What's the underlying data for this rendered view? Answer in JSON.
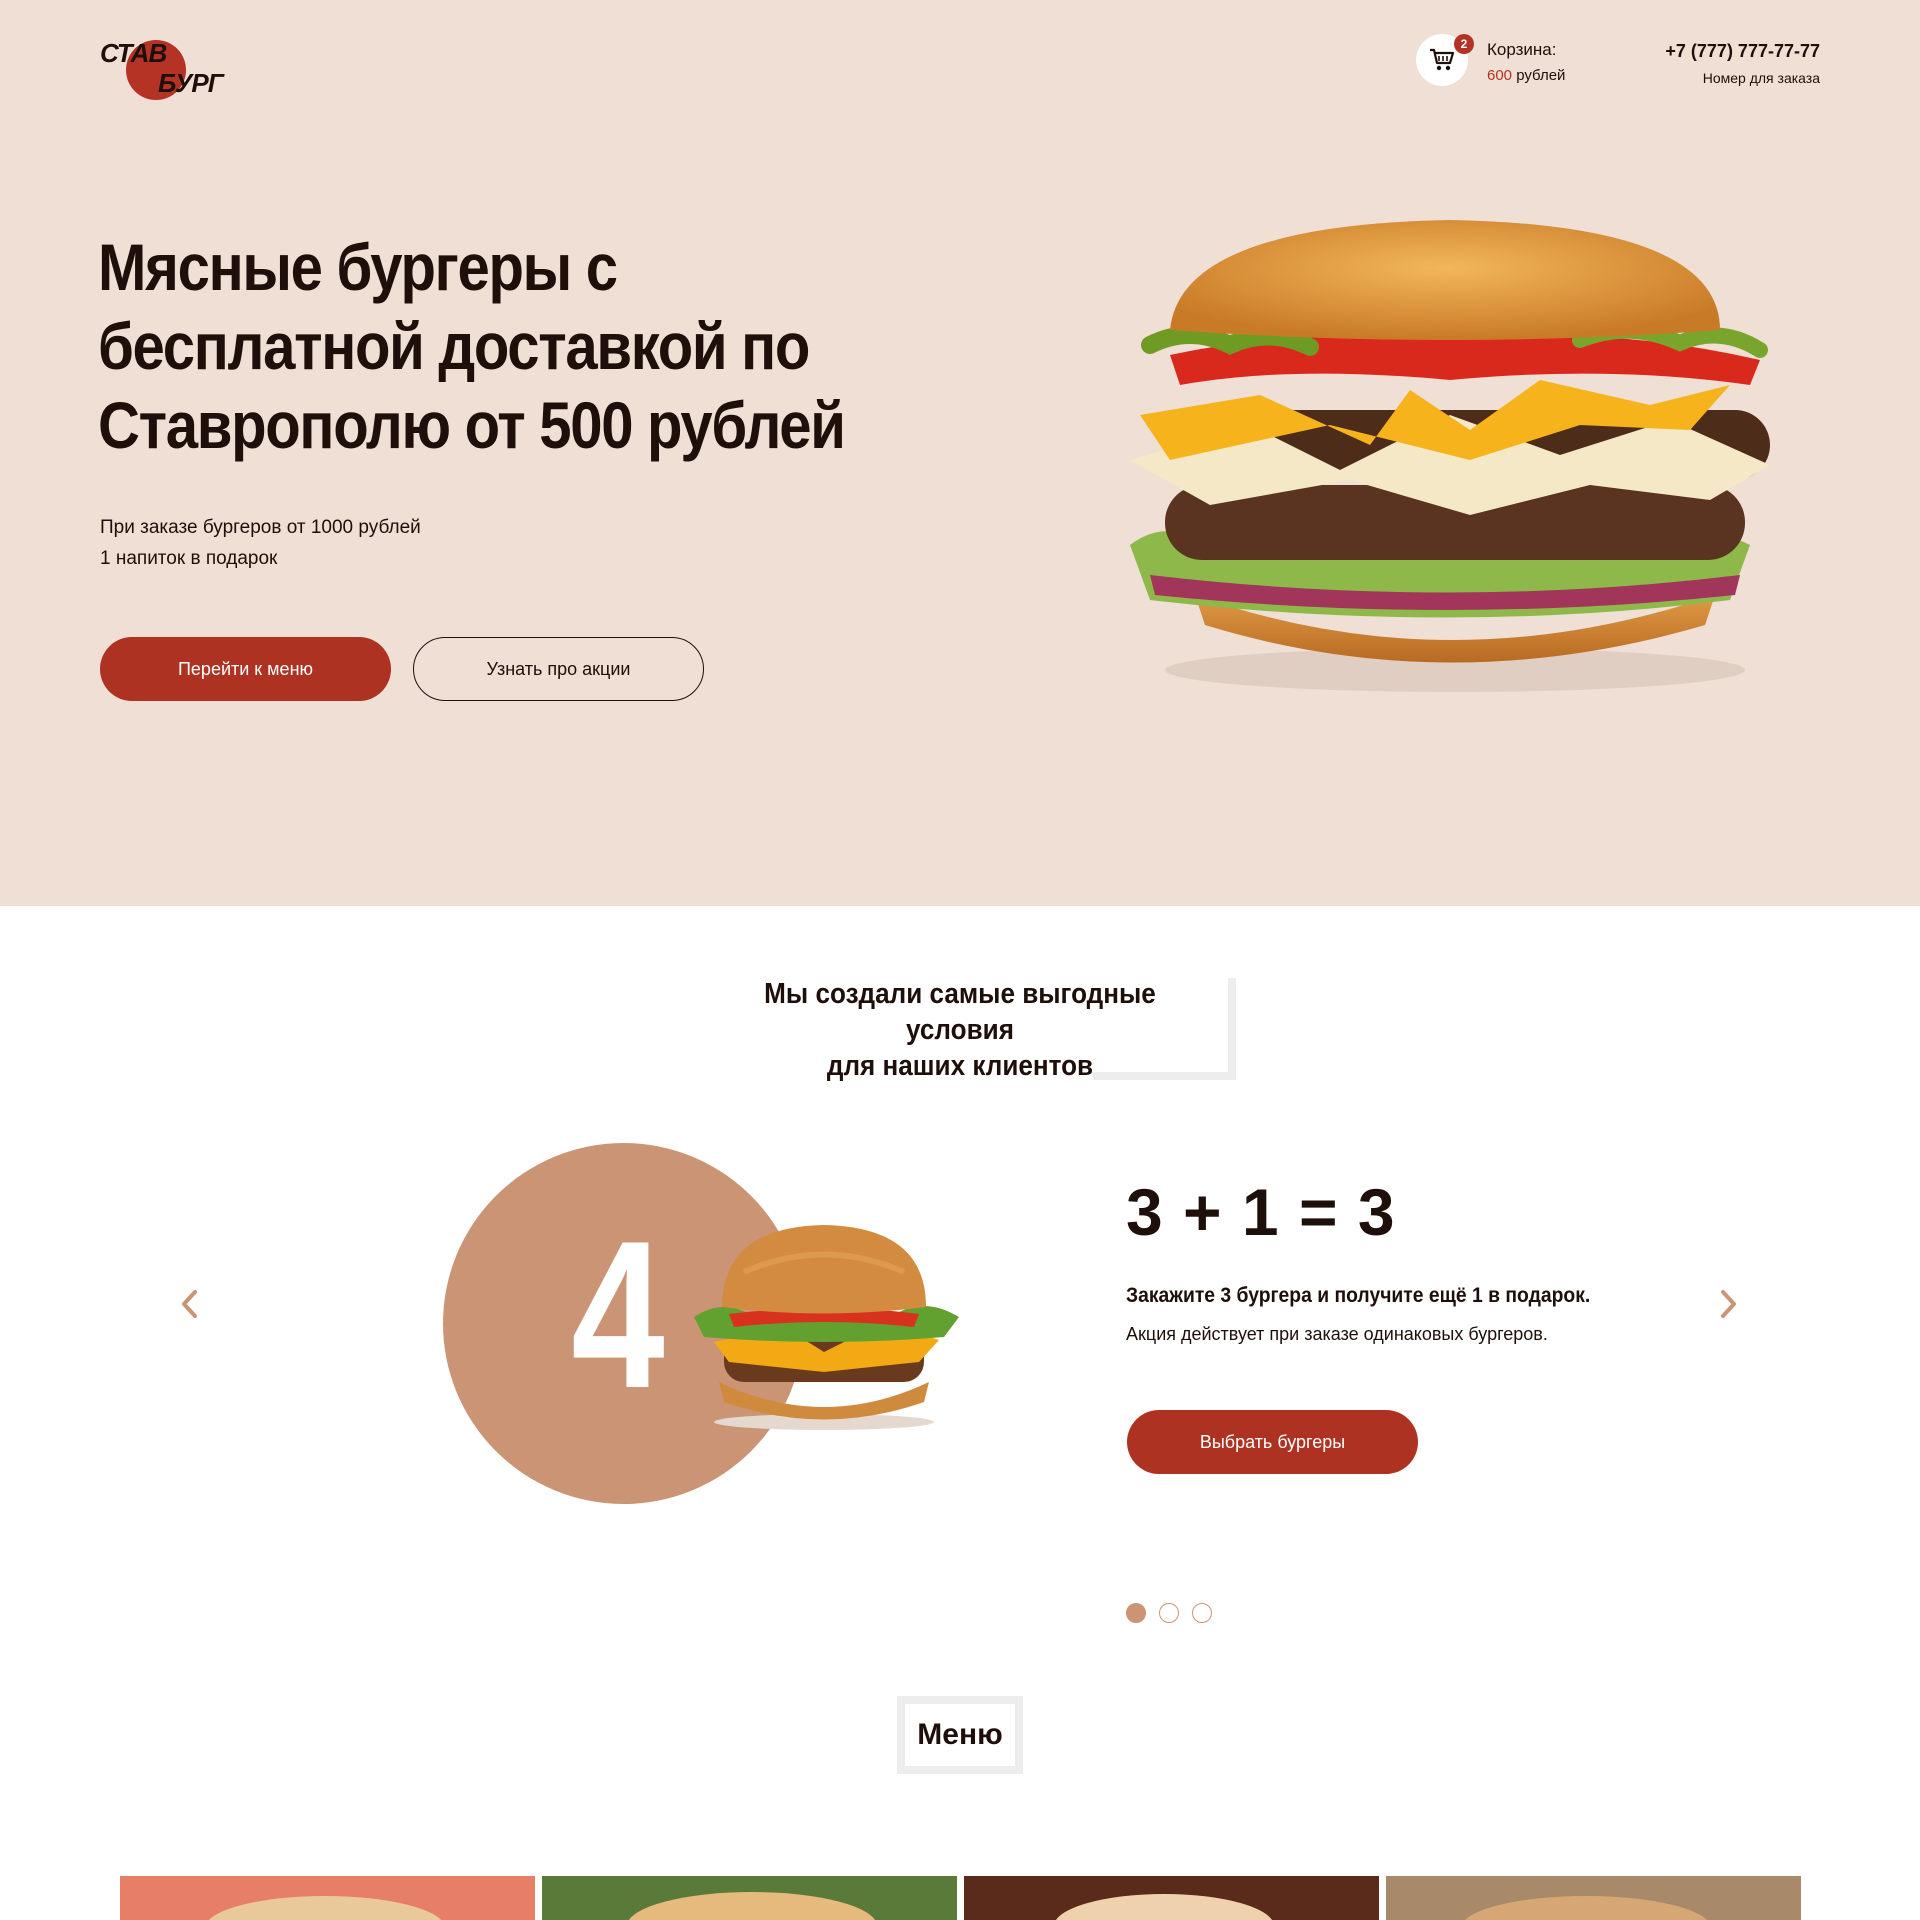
{
  "logo": {
    "line1": "СТАВ",
    "line2": "БУРГ"
  },
  "cart": {
    "label": "Корзина:",
    "count": "2",
    "amount": "600",
    "currency": "рублей"
  },
  "contact": {
    "phone": "+7 (777) 777-77-77",
    "caption": "Номер для заказа"
  },
  "hero": {
    "title": "Мясные бургеры с бесплатной доставкой по Ставрополю от 500 рублей",
    "subtitle_line1": "При заказе бургеров от 1000 рублей",
    "subtitle_line2": "1 напиток в подарок",
    "btn_menu": "Перейти к меню",
    "btn_promo": "Узнать про акции"
  },
  "conditions": {
    "title_line1": "Мы создали самые выгодные условия",
    "title_line2": "для наших клиентов"
  },
  "promo_slide": {
    "number": "4",
    "equation": "3 + 1 = 3",
    "lead": "Закажите 3 бургера и получите ещё 1 в подарок.",
    "note": "Акция действует при заказе одинаковых бургеров.",
    "button": "Выбрать бургеры",
    "dots_total": 3,
    "active_dot": 1
  },
  "menu": {
    "title": "Меню"
  },
  "colors": {
    "hero_bg": "#efdfd4",
    "accent": "#ae3221",
    "promo_circle": "#cb9575",
    "text": "#1e0f0b"
  },
  "icons": [
    "cart-icon",
    "chevron-left-icon",
    "chevron-right-icon"
  ]
}
